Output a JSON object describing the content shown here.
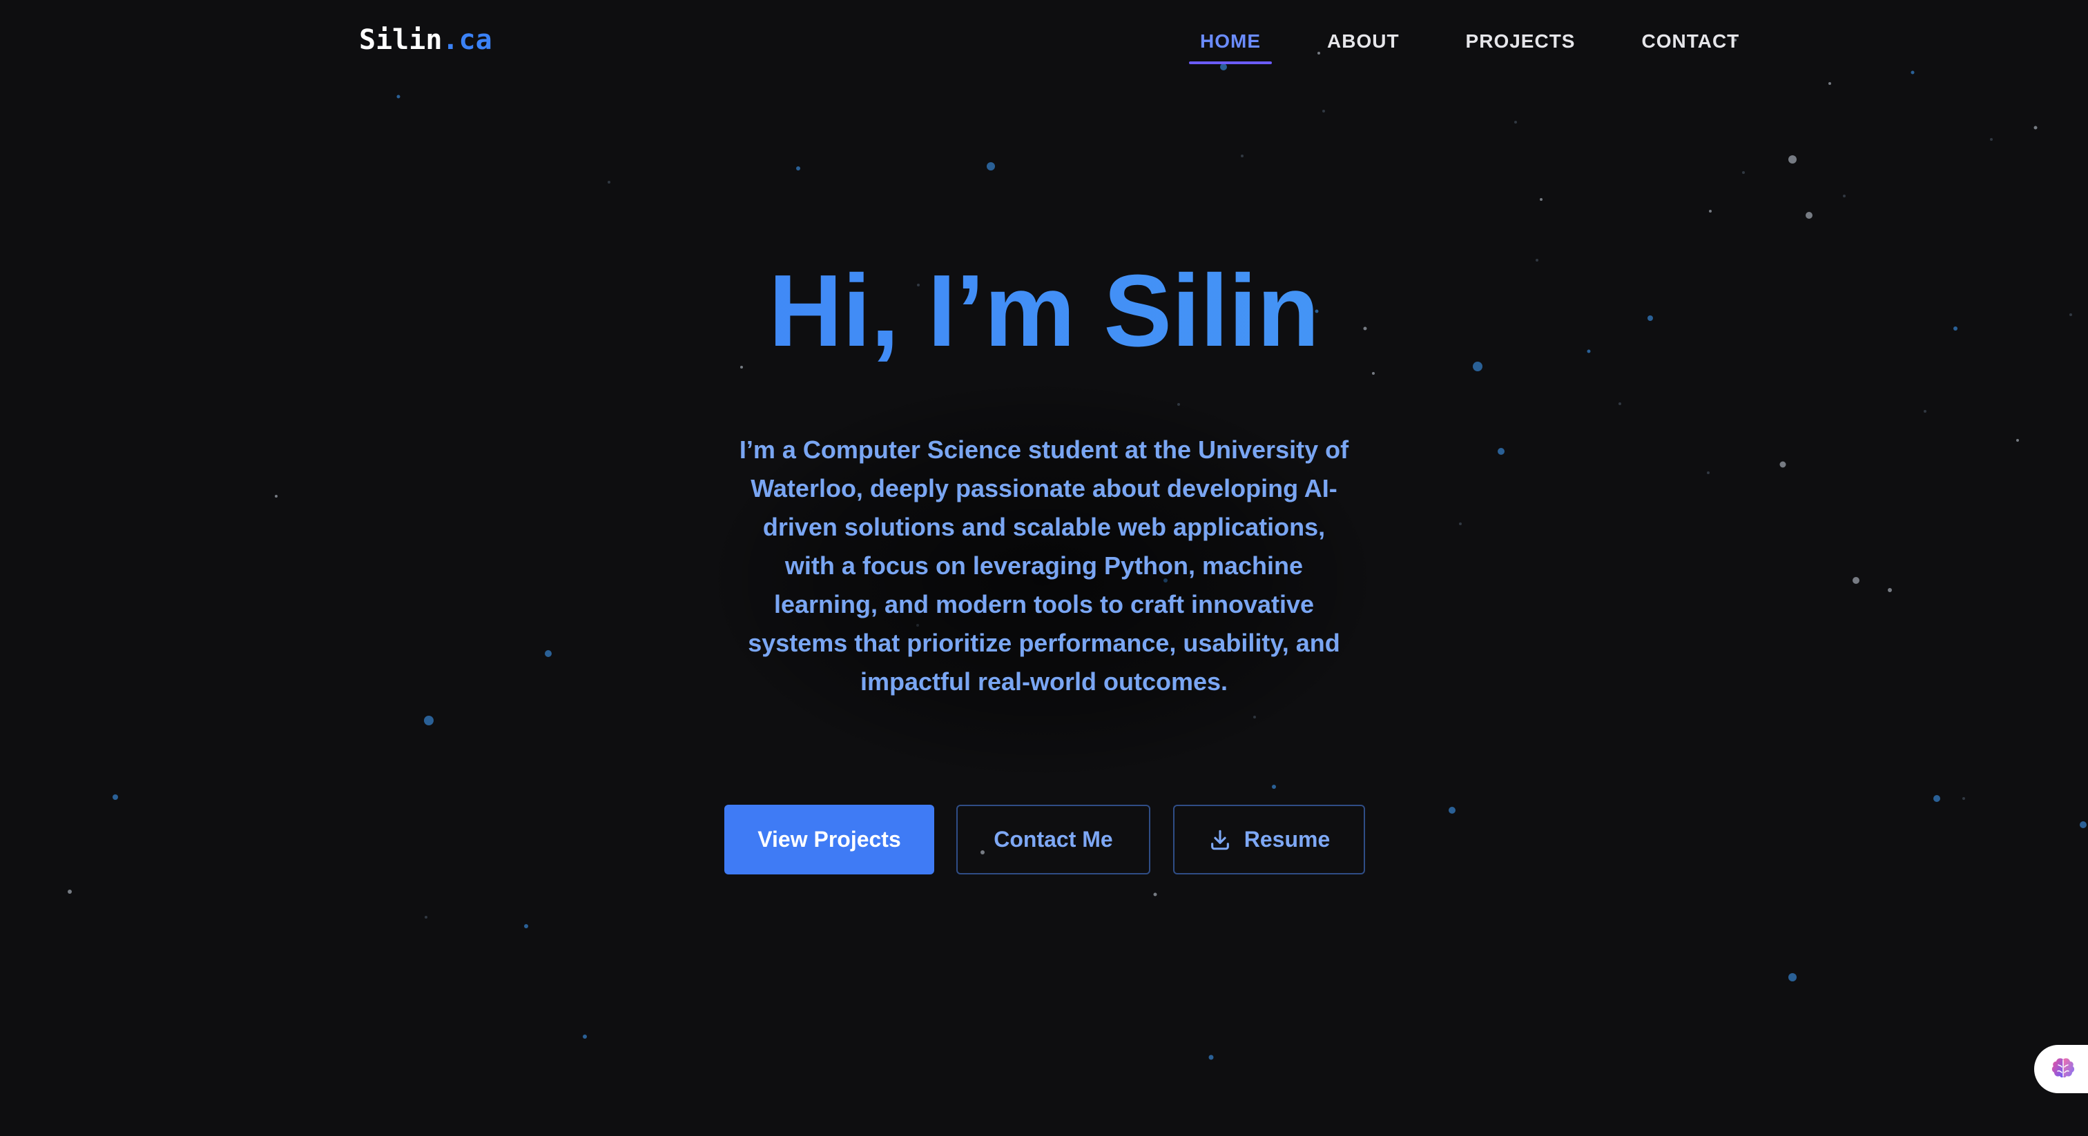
{
  "logo": {
    "name": "Silin",
    "tld": ".ca"
  },
  "nav": {
    "items": [
      {
        "label": "HOME",
        "active": true
      },
      {
        "label": "ABOUT",
        "active": false
      },
      {
        "label": "PROJECTS",
        "active": false
      },
      {
        "label": "CONTACT",
        "active": false
      }
    ]
  },
  "hero": {
    "title": "Hi, I’m Silin",
    "description": "I’m a Computer Science student at the University of Waterloo, deeply passionate about developing AI-driven solutions and scalable web applications, with a focus on leveraging Python, machine learning, and modern tools to craft innovative systems that prioritize performance, usability, and impactful real-world outcomes.",
    "buttons": {
      "primary": "View Projects",
      "contact": "Contact Me",
      "resume": "Resume"
    }
  },
  "widget": {
    "icon": "brain-icon"
  },
  "colors": {
    "background": "#0e0e10",
    "accent": "#3f7bf5",
    "title_gradient_start": "#3b7cf6",
    "title_gradient_end": "#4aa2f5",
    "description": "#7aa6f3",
    "nav_active": "#6b8cff"
  }
}
